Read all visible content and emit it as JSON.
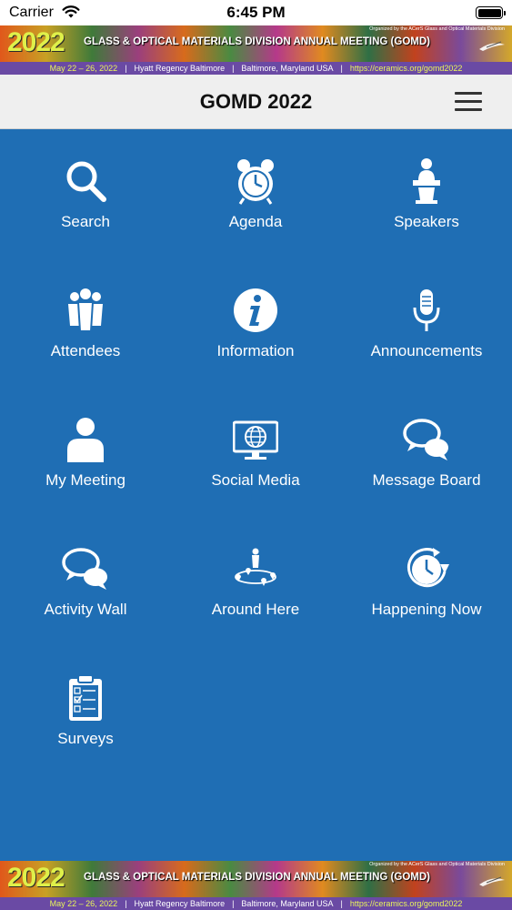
{
  "status_bar": {
    "carrier": "Carrier",
    "time": "6:45 PM"
  },
  "banner": {
    "year": "2022",
    "title": "GLASS & OPTICAL MATERIALS DIVISION ANNUAL MEETING (GOMD)",
    "organizer": "Organized by the ACerS Glass and Optical Materials Division",
    "dates": "May 22 – 26, 2022",
    "venue": "Hyatt Regency Baltimore",
    "location": "Baltimore, Maryland USA",
    "url": "https://ceramics.org/gomd2022",
    "separator": "|"
  },
  "navbar": {
    "title": "GOMD 2022"
  },
  "menu": [
    {
      "label": "Search",
      "icon": "search-icon"
    },
    {
      "label": "Agenda",
      "icon": "alarm-clock-icon"
    },
    {
      "label": "Speakers",
      "icon": "podium-speaker-icon"
    },
    {
      "label": "Attendees",
      "icon": "people-group-icon"
    },
    {
      "label": "Information",
      "icon": "info-icon"
    },
    {
      "label": "Announcements",
      "icon": "microphone-icon"
    },
    {
      "label": "My Meeting",
      "icon": "person-icon"
    },
    {
      "label": "Social Media",
      "icon": "globe-monitor-icon"
    },
    {
      "label": "Message Board",
      "icon": "chat-bubbles-icon"
    },
    {
      "label": "Activity Wall",
      "icon": "chat-bubbles-icon"
    },
    {
      "label": "Around Here",
      "icon": "location-map-icon"
    },
    {
      "label": "Happening Now",
      "icon": "clock-arrow-icon"
    },
    {
      "label": "Surveys",
      "icon": "clipboard-checklist-icon"
    }
  ],
  "colors": {
    "background": "#1f6eb4",
    "navbar": "#efefef",
    "banner_bar": "#6a4aa4",
    "banner_year": "#dff04a"
  }
}
